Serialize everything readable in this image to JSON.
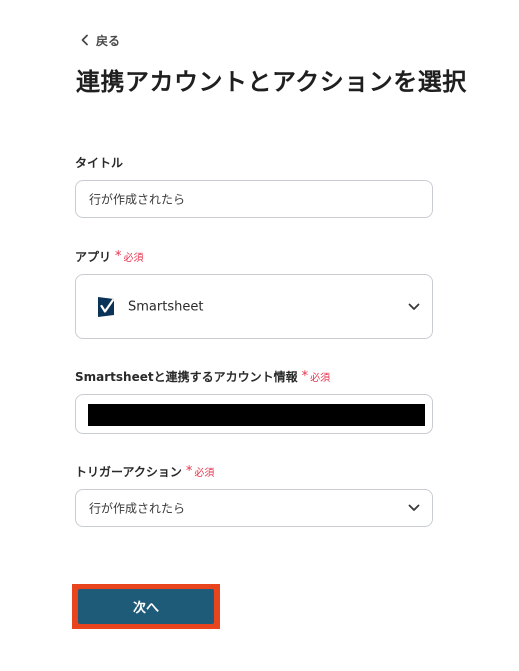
{
  "nav": {
    "back_label": "戻る"
  },
  "page": {
    "title": "連携アカウントとアクションを選択"
  },
  "required_label": "必須",
  "fields": {
    "title": {
      "label": "タイトル",
      "value": "行が作成されたら"
    },
    "app": {
      "label": "アプリ",
      "selected": "Smartsheet",
      "icon": "smartsheet-logo-icon"
    },
    "account": {
      "label": "Smartsheetと連携するアカウント情報",
      "value_redacted": true
    },
    "trigger_action": {
      "label": "トリガーアクション",
      "selected": "行が作成されたら"
    }
  },
  "actions": {
    "next_label": "次へ"
  },
  "colors": {
    "required": "#e5334d",
    "button": "#1e5b78",
    "highlight": "#e8451f",
    "border": "#c9cdd2",
    "smartsheet_brand": "#0b3357"
  }
}
